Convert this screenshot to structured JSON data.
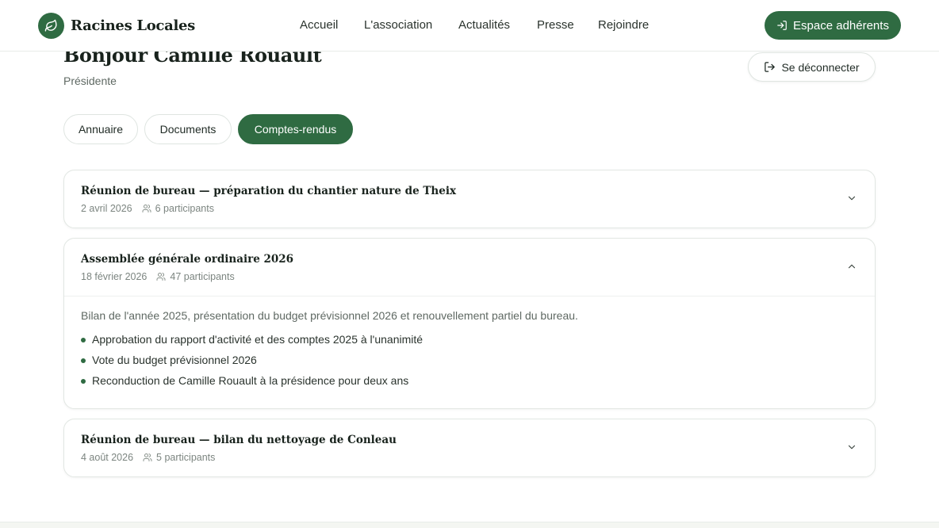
{
  "brand": {
    "name": "Racines Locales",
    "logo_icon": "leaf-icon",
    "accent": "#2f6b42"
  },
  "nav": {
    "items": [
      {
        "label": "Accueil"
      },
      {
        "label": "L'association"
      },
      {
        "label": "Actualités"
      },
      {
        "label": "Presse"
      },
      {
        "label": "Rejoindre"
      }
    ],
    "member_button": {
      "label": "Espace adhérents",
      "icon": "login-icon"
    }
  },
  "user": {
    "greeting": "Bonjour Camille Rouault",
    "role": "Présidente",
    "logout_label": "Se déconnecter",
    "logout_icon": "logout-icon"
  },
  "tabs": [
    {
      "label": "Annuaire",
      "active": false
    },
    {
      "label": "Documents",
      "active": false
    },
    {
      "label": "Comptes-rendus",
      "active": true
    }
  ],
  "meetings": [
    {
      "title": "Réunion de bureau — préparation du chantier nature de Theix",
      "date": "2 avril 2026",
      "participants": "6 participants",
      "expanded": false
    },
    {
      "title": "Assemblée générale ordinaire 2026",
      "date": "18 février 2026",
      "participants": "47 participants",
      "expanded": true,
      "summary": "Bilan de l'année 2025, présentation du budget prévisionnel 2026 et renouvellement partiel du bureau.",
      "points": [
        "Approbation du rapport d'activité et des comptes 2025 à l'unanimité",
        "Vote du budget prévisionnel 2026",
        "Reconduction de Camille Rouault à la présidence pour deux ans"
      ]
    },
    {
      "title": "Réunion de bureau — bilan du nettoyage de Conleau",
      "date": "4 août 2026",
      "participants": "5 participants",
      "expanded": false
    }
  ]
}
